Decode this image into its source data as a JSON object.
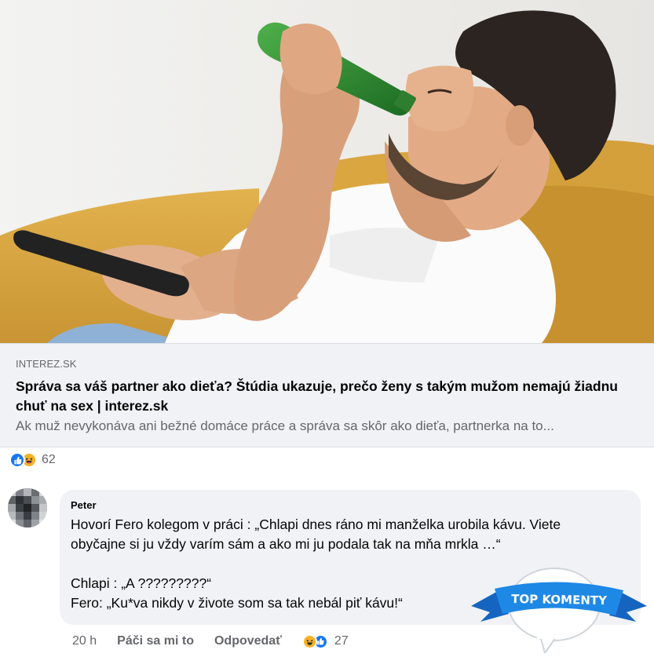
{
  "link_preview": {
    "domain": "INTEREZ.SK",
    "title": "Správa sa váš partner ako dieťa? Štúdia ukazuje, prečo ženy s takým mužom nemajú žiadnu chuť na sex | interez.sk",
    "description": "Ak muž nevykonáva ani bežné domáce práce a správa sa skôr ako dieťa, partnerka na to..."
  },
  "post_reactions": {
    "icons": [
      "like-icon",
      "haha-icon"
    ],
    "count": "62"
  },
  "comment": {
    "author": "Peter",
    "lines": [
      "Hovorí Fero kolegom v práci : „Chlapi dnes ráno mi manželka urobila kávu. Viete",
      "obyčajne si ju vždy varím sám a ako mi ju podala tak na mňa mrkla …“",
      "",
      "Chlapi : „A ?????????“",
      "Fero: „Ku*va nikdy v živote som sa tak nebál piť kávu!“"
    ],
    "badge_text": "TOP KOMENTY",
    "time": "20 h",
    "like_label": "Páči sa mi to",
    "reply_label": "Odpovedať",
    "reaction_icons": [
      "haha-icon",
      "like-icon"
    ],
    "reaction_count": "27"
  },
  "colors": {
    "accent_blue": "#1877f2",
    "haha_yellow": "#f7b125",
    "badge_blue": "#1e88e5",
    "muted_text": "#65676b",
    "bubble_bg": "#f0f2f5"
  }
}
